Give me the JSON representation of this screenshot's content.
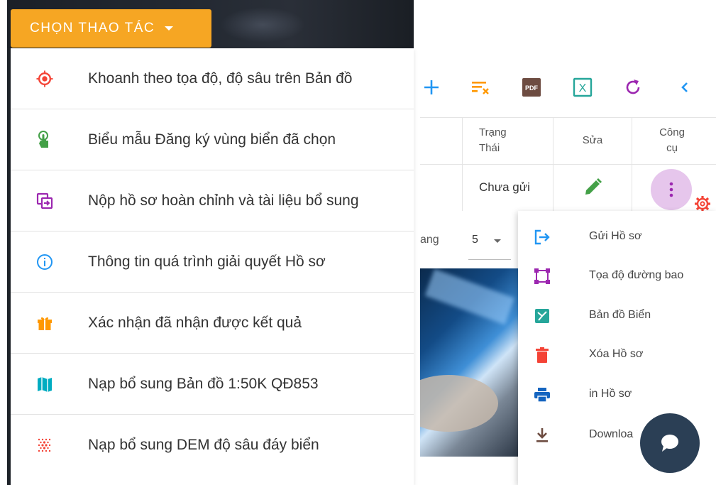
{
  "action_button": {
    "label": "CHỌN THAO TÁC",
    "color": "#f6a623"
  },
  "action_menu": {
    "items": [
      {
        "label": "Khoanh theo tọa độ, độ sâu trên Bản đồ",
        "icon": "target-icon",
        "color": "#f44336"
      },
      {
        "label": "Biểu mẫu Đăng ký vùng biển đã chọn",
        "icon": "touch-app-icon",
        "color": "#43a047"
      },
      {
        "label": "Nộp hồ sơ hoàn chỉnh và tài liệu bổ sung",
        "icon": "copy-submit-icon",
        "color": "#9c27b0"
      },
      {
        "label": "Thông tin quá trình giải quyết Hồ sơ",
        "icon": "info-icon",
        "color": "#2196f3"
      },
      {
        "label": "Xác nhận đã nhận được kết quả",
        "icon": "gift-icon",
        "color": "#ff9800"
      },
      {
        "label": "Nạp bổ sung Bản đồ 1:50K QĐ853",
        "icon": "map-icon",
        "color": "#00acc1"
      },
      {
        "label": "Nạp bổ sung DEM độ sâu đáy biển",
        "icon": "grain-icon",
        "color": "#f44336"
      }
    ]
  },
  "toolbar": {
    "icons": [
      {
        "name": "add-icon",
        "color": "#2196f3"
      },
      {
        "name": "clear-filter-icon",
        "color": "#ff9800"
      },
      {
        "name": "pdf-icon",
        "label": "PDF",
        "color": "#6d4c41"
      },
      {
        "name": "excel-icon",
        "label": "X",
        "color": "#26a69a"
      },
      {
        "name": "refresh-icon",
        "color": "#9c27b0"
      },
      {
        "name": "chevron-left-icon",
        "color": "#2196f3"
      }
    ]
  },
  "table": {
    "headers": {
      "status_line1": "Trạng",
      "status_line2": "Thái",
      "edit": "Sửa",
      "tools_line1": "Công",
      "tools_line2": "cụ"
    },
    "row": {
      "status": "Chưa gửi"
    }
  },
  "pagination": {
    "label_fragment": "ang",
    "page_size": "5"
  },
  "tools_menu": {
    "items": [
      {
        "label": "Gửi Hồ sơ",
        "icon": "send-icon",
        "color": "#2196f3"
      },
      {
        "label": "Tọa độ đường bao",
        "icon": "polygon-icon",
        "color": "#9c27b0"
      },
      {
        "label": "Bản đồ Biển",
        "icon": "sea-map-icon",
        "color": "#26a69a"
      },
      {
        "label": "Xóa Hồ sơ",
        "icon": "trash-icon",
        "color": "#f44336"
      },
      {
        "label": "in Hồ sơ",
        "icon": "print-icon",
        "color": "#1565c0"
      },
      {
        "label": "Downloa",
        "icon": "download-icon",
        "color": "#6d4c41"
      }
    ]
  }
}
